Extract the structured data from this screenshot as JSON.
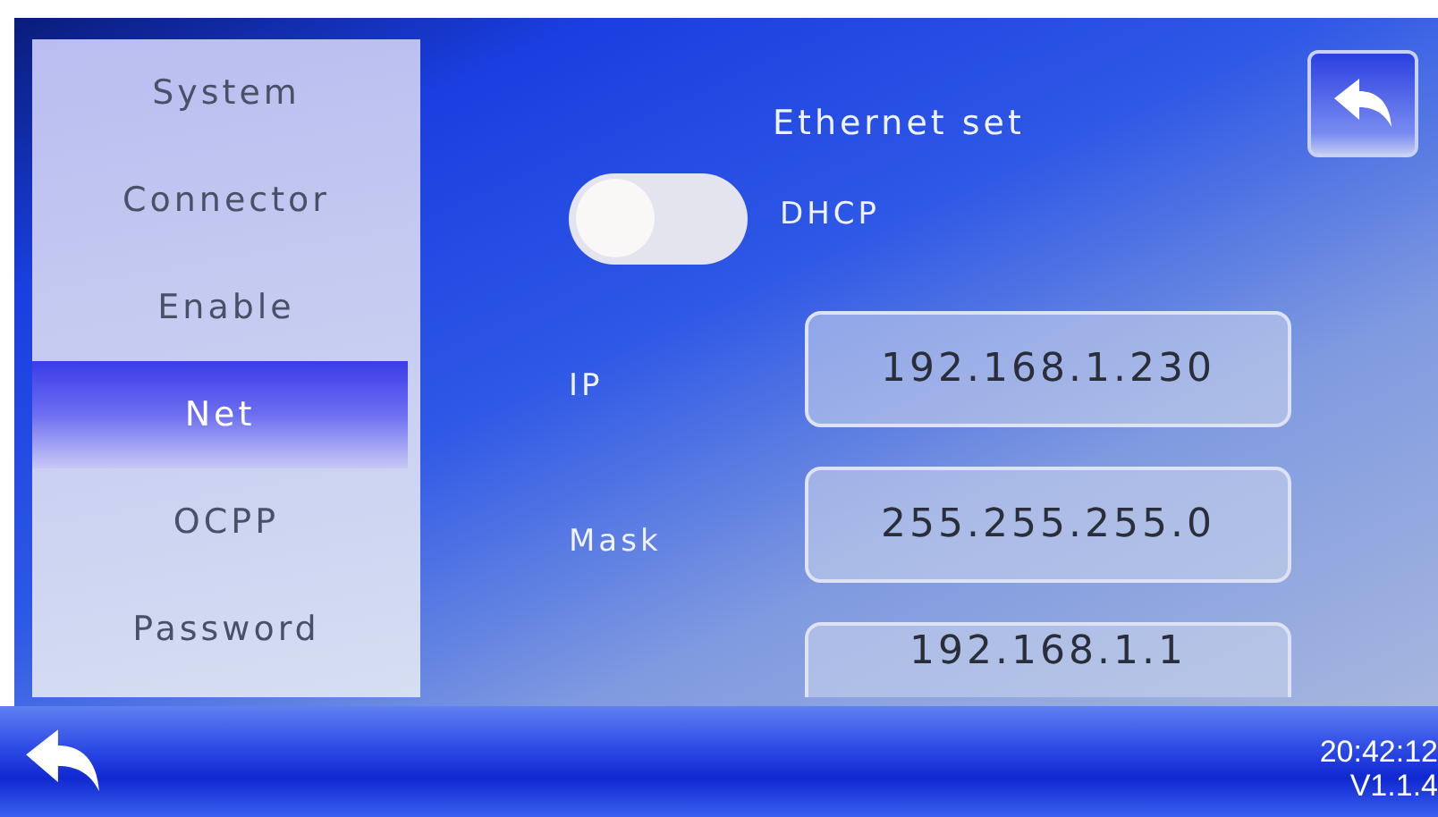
{
  "sidebar": {
    "items": [
      {
        "label": "System",
        "selected": false
      },
      {
        "label": "Connector",
        "selected": false
      },
      {
        "label": "Enable",
        "selected": false
      },
      {
        "label": "Net",
        "selected": true
      },
      {
        "label": "OCPP",
        "selected": false
      },
      {
        "label": "Password",
        "selected": false
      }
    ]
  },
  "title": "Ethernet set",
  "dhcp": {
    "label": "DHCP",
    "on": false
  },
  "fields": [
    {
      "label": "IP",
      "value": "192.168.1.230"
    },
    {
      "label": "Mask",
      "value": "255.255.255.0"
    },
    {
      "value": "192.168.1.1"
    }
  ],
  "status_bar": {
    "time": "20:42:12",
    "version": "V1.1.4"
  }
}
